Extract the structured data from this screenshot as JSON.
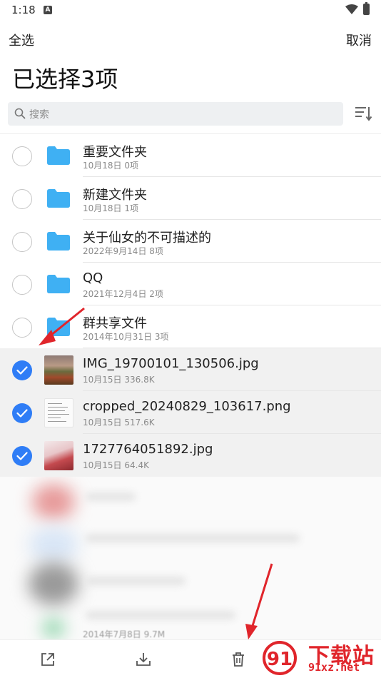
{
  "status_bar": {
    "time": "1:18",
    "notification_badge": "A"
  },
  "header": {
    "select_all_label": "全选",
    "cancel_label": "取消",
    "title": "已选择3项"
  },
  "search": {
    "placeholder": "搜索"
  },
  "files": [
    {
      "name": "重要文件夹",
      "date": "10月18日",
      "detail": "0项",
      "kind": "folder",
      "selected": false
    },
    {
      "name": "新建文件夹",
      "date": "10月18日",
      "detail": "1项",
      "kind": "folder",
      "selected": false
    },
    {
      "name": "关于仙女的不可描述的",
      "date": "2022年9月14日",
      "detail": "8项",
      "kind": "folder",
      "selected": false
    },
    {
      "name": "QQ",
      "date": "2021年12月4日",
      "detail": "2项",
      "kind": "folder",
      "selected": false
    },
    {
      "name": "群共享文件",
      "date": "2014年10月31日",
      "detail": "3项",
      "kind": "folder",
      "selected": false
    },
    {
      "name": "IMG_19700101_130506.jpg",
      "date": "10月15日",
      "detail": "336.8K",
      "kind": "image-landscape",
      "selected": true
    },
    {
      "name": "cropped_20240829_103617.png",
      "date": "10月15日",
      "detail": "517.6K",
      "kind": "image-doc",
      "selected": true
    },
    {
      "name": "1727764051892.jpg",
      "date": "10月15日",
      "detail": "64.4K",
      "kind": "image-photo",
      "selected": true
    }
  ],
  "blurred_row_meta": "2014年7月8日 9.7M",
  "bottom_bar": {
    "icons": [
      "share-icon",
      "download-icon",
      "trash-icon"
    ]
  },
  "watermark": {
    "logo_text": "91",
    "title": "下载站",
    "url": "91xz.net"
  },
  "colors": {
    "accent": "#2f7df6",
    "folder": "#3fb0f3",
    "annotation": "#e0252b"
  }
}
